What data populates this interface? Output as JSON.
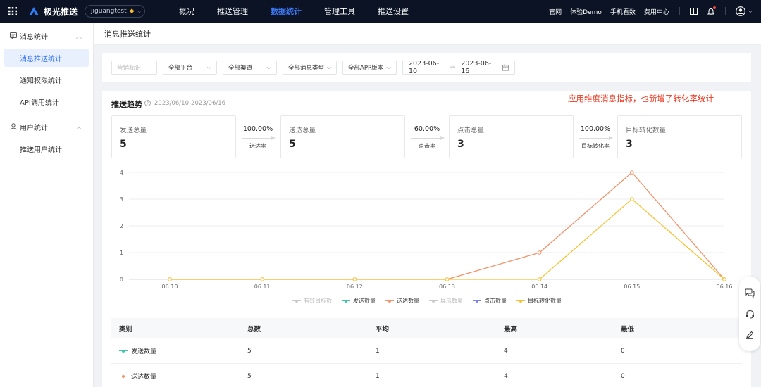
{
  "topbar": {
    "logo_text": "极光推送",
    "app_selector": "jiguangtest",
    "nav": [
      {
        "label": "概况",
        "active": false
      },
      {
        "label": "推送管理",
        "active": false
      },
      {
        "label": "数据统计",
        "active": true
      },
      {
        "label": "管理工具",
        "active": false
      },
      {
        "label": "推送设置",
        "active": false
      }
    ],
    "links": [
      "官网",
      "体验Demo",
      "手机看数",
      "费用中心"
    ],
    "icons": [
      "book-icon",
      "bell-icon",
      "user-avatar-icon"
    ]
  },
  "sidebar": {
    "groups": [
      {
        "label": "消息统计",
        "icon": "message-icon",
        "items": [
          "消息推送统计",
          "通知权限统计",
          "API调用统计"
        ]
      },
      {
        "label": "用户统计",
        "icon": "user-icon",
        "items": [
          "推送用户统计"
        ]
      }
    ],
    "active_item": "消息推送统计"
  },
  "page": {
    "title": "消息推送统计"
  },
  "filters": {
    "tag_placeholder": "营销标识",
    "platform": "全部平台",
    "channel": "全部渠道",
    "message_type": "全部消息类型",
    "app_version": "全部APP版本",
    "date_start": "2023-06-10",
    "date_end": "2023-06-16"
  },
  "trend": {
    "title": "推送趋势",
    "range": "2023/06/10-2023/06/16",
    "annotation": "应用维度消息指标，也新增了转化率统计"
  },
  "metrics": [
    {
      "label": "发送总量",
      "value": "5"
    },
    {
      "label": "送达总量",
      "value": "5"
    },
    {
      "label": "点击总量",
      "value": "3"
    },
    {
      "label": "目标转化数量",
      "value": "3"
    }
  ],
  "rates": [
    {
      "pct": "100.00%",
      "label": "送达率"
    },
    {
      "pct": "60.00%",
      "label": "点击率"
    },
    {
      "pct": "100.00%",
      "label": "目标转化率"
    }
  ],
  "chart_data": {
    "type": "line",
    "x": [
      "06.10",
      "06.11",
      "06.12",
      "06.13",
      "06.14",
      "06.15",
      "06.16"
    ],
    "ylim": [
      0,
      4
    ],
    "yticks": [
      "0",
      "1",
      "2",
      "3",
      "4"
    ],
    "grid": true,
    "legend_position": "bottom",
    "series": [
      {
        "name": "有效目标数",
        "color": "#c9c9c9",
        "enabled": false,
        "values": []
      },
      {
        "name": "发送数量",
        "color": "#3ec6a8",
        "enabled": true,
        "values": []
      },
      {
        "name": "送达数量",
        "color": "#f0936a",
        "enabled": true,
        "values": [
          0,
          0,
          0,
          0,
          1,
          4,
          0
        ]
      },
      {
        "name": "展示数量",
        "color": "#c9c9c9",
        "enabled": false,
        "values": []
      },
      {
        "name": "点击数量",
        "color": "#7b86e8",
        "enabled": true,
        "values": []
      },
      {
        "name": "目标转化数量",
        "color": "#f5c232",
        "enabled": true,
        "values": [
          0,
          0,
          0,
          0,
          0,
          3,
          0
        ]
      }
    ]
  },
  "table": {
    "headers": [
      "类别",
      "总数",
      "平均",
      "最高",
      "最低"
    ],
    "rows": [
      {
        "name": "发送数量",
        "color": "#3ec6a8",
        "total": "5",
        "avg": "1",
        "max": "4",
        "min": "0"
      },
      {
        "name": "送达数量",
        "color": "#f0936a",
        "total": "5",
        "avg": "1",
        "max": "4",
        "min": "0"
      }
    ]
  },
  "float_panel": {
    "icons": [
      "chat-icon",
      "headset-icon",
      "edit-icon"
    ]
  }
}
